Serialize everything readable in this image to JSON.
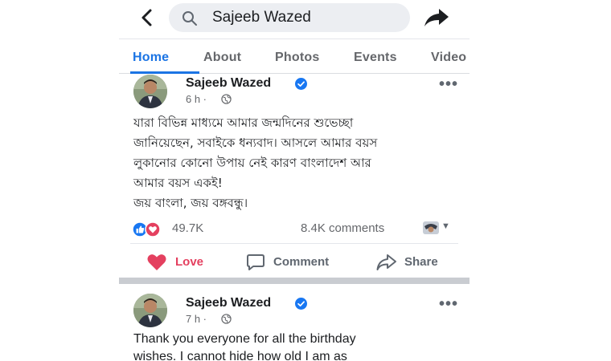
{
  "search": {
    "value": "Sajeeb Wazed"
  },
  "tabs": [
    {
      "label": "Home",
      "active": true
    },
    {
      "label": "About"
    },
    {
      "label": "Photos"
    },
    {
      "label": "Events"
    },
    {
      "label": "Video"
    }
  ],
  "posts": [
    {
      "author": "Sajeeb Wazed",
      "time": "6 h ·",
      "body_lines": [
        "যারা বিভিন্ন মাধ্যমে আমার জন্মদিনের শুভেচ্ছা",
        "জানিয়েছেন, সবাইকে ধন্যবাদ। আসলে আমার বয়স",
        "লুকানোর কোনো উপায় নেই কারণ বাংলাদেশ আর",
        "আমার বয়স একই!"
      ],
      "closing": "জয় বাংলা, জয় বঙ্গবন্ধু।",
      "reactions": "49.7K",
      "comments": "8.4K comments",
      "actions": {
        "love": "Love",
        "comment": "Comment",
        "share": "Share"
      }
    },
    {
      "author": "Sajeeb Wazed",
      "time": "7 h ·",
      "body_lines": [
        "Thank you everyone for all the birthday",
        "wishes. I cannot hide how old I am as"
      ]
    }
  ],
  "colors": {
    "accent": "#1b74e4",
    "verified": "#1877f2",
    "love": "#e4405f",
    "like": "#1877f2",
    "muted": "#65676b"
  },
  "icons": [
    "back-arrow-icon",
    "search-icon",
    "share-arrow-icon",
    "verified-icon",
    "globe-icon",
    "more-icon",
    "like-icon",
    "love-icon",
    "comment-icon",
    "share-icon"
  ]
}
